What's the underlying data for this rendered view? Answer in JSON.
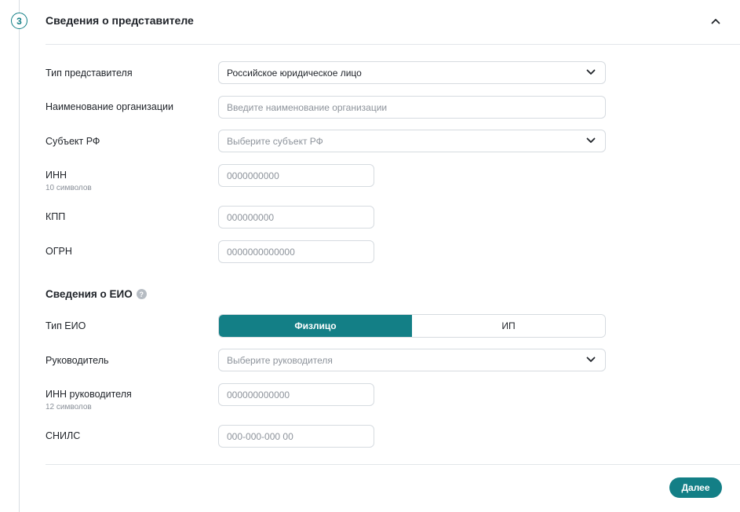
{
  "section": {
    "step_number": "3",
    "title": "Сведения о представителе"
  },
  "form": {
    "rep_type": {
      "label": "Тип представителя",
      "value": "Российское юридическое лицо"
    },
    "org_name": {
      "label": "Наименование организации",
      "placeholder": "Введите наименование организации"
    },
    "region": {
      "label": "Субъект РФ",
      "placeholder": "Выберите субъект РФ"
    },
    "inn": {
      "label": "ИНН",
      "hint": "10 символов",
      "placeholder": "0000000000"
    },
    "kpp": {
      "label": "КПП",
      "placeholder": "000000000"
    },
    "ogrn": {
      "label": "ОГРН",
      "placeholder": "0000000000000"
    }
  },
  "eio": {
    "title": "Сведения о ЕИО",
    "help_icon": "?",
    "type": {
      "label": "Тип ЕИО",
      "options": [
        "Физлицо",
        "ИП"
      ],
      "selected": "Физлицо"
    },
    "head": {
      "label": "Руководитель",
      "placeholder": "Выберите руководителя"
    },
    "head_inn": {
      "label": "ИНН руководителя",
      "hint": "12 символов",
      "placeholder": "000000000000"
    },
    "snils": {
      "label": "СНИЛС",
      "placeholder": "000-000-000 00"
    }
  },
  "actions": {
    "next_label": "Далее"
  },
  "colors": {
    "accent": "#137f86",
    "border": "#d6dbe0",
    "divider": "#e3e6ea"
  }
}
